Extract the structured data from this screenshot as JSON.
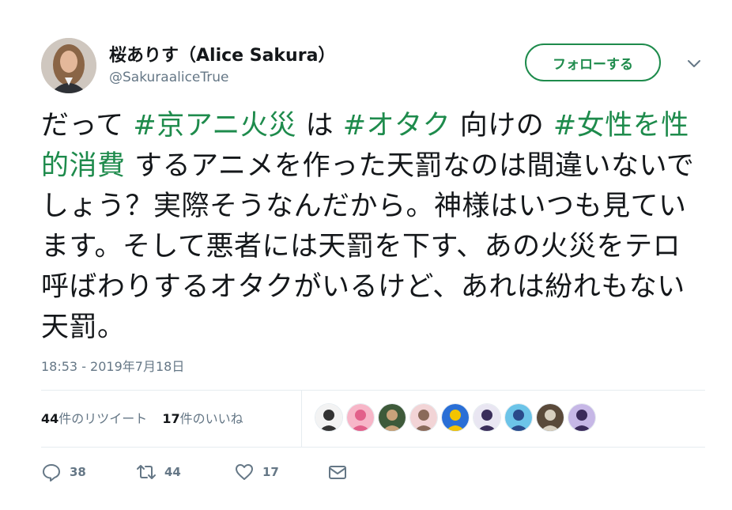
{
  "author": {
    "display_name": "桜ありす（Alice Sakura）",
    "handle": "@SakuraaliceTrue"
  },
  "follow_button_label": "フォローする",
  "tweet": {
    "segments": [
      {
        "text": "だって ",
        "hashtag": false
      },
      {
        "text": "#京アニ火災",
        "hashtag": true
      },
      {
        "text": " は ",
        "hashtag": false
      },
      {
        "text": "#オタク",
        "hashtag": true
      },
      {
        "text": " 向けの ",
        "hashtag": false
      },
      {
        "text": "#女性を性的消費",
        "hashtag": true
      },
      {
        "text": " するアニメを作った天罰なのは間違いないでしょう？実際そうなんだから。神様はいつも見ています。そして悪者には天罰を下す、あの火災をテロ呼ばわりするオタクがいるけど、あれは紛れもない天罰。",
        "hashtag": false
      }
    ],
    "timestamp": "18:53 - 2019年7月18日"
  },
  "stats": {
    "retweets_count": "44",
    "retweets_label": "件のリツイート",
    "likes_count": "17",
    "likes_label": "件のいいね"
  },
  "actions": {
    "reply_count": "38",
    "retweet_count": "44",
    "like_count": "17"
  },
  "colors": {
    "accent": "#1e8b4c",
    "secondary_text": "#657786",
    "divider": "#e6ecf0"
  },
  "icons": [
    "chevron-down-icon",
    "reply-icon",
    "retweet-icon",
    "heart-icon",
    "envelope-icon"
  ],
  "liker_avatars": [
    {
      "name": "liker-avatar-1",
      "bg": "#f3f3f3",
      "fg": "#333333"
    },
    {
      "name": "liker-avatar-2",
      "bg": "#f7b6c8",
      "fg": "#e2608a"
    },
    {
      "name": "liker-avatar-3",
      "bg": "#3e5a3a",
      "fg": "#c9a27a"
    },
    {
      "name": "liker-avatar-4",
      "bg": "#f2d4d6",
      "fg": "#8a6a5a"
    },
    {
      "name": "liker-avatar-5",
      "bg": "#2a6fd6",
      "fg": "#f4c400"
    },
    {
      "name": "liker-avatar-6",
      "bg": "#e9e6f2",
      "fg": "#3a2e5a"
    },
    {
      "name": "liker-avatar-7",
      "bg": "#6cc4e8",
      "fg": "#2a4a8a"
    },
    {
      "name": "liker-avatar-8",
      "bg": "#5a4a3a",
      "fg": "#d8d0c0"
    },
    {
      "name": "liker-avatar-9",
      "bg": "#c6b7e6",
      "fg": "#3a2a5a"
    }
  ]
}
